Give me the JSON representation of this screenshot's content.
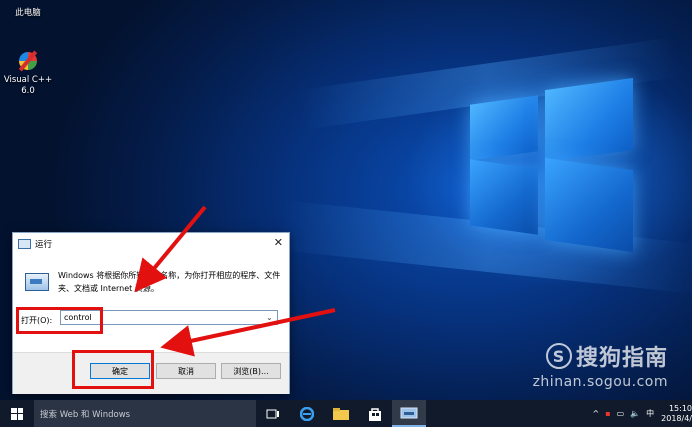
{
  "desktop": {
    "icons": [
      {
        "label": "此电脑"
      },
      {
        "label": "Visual C++",
        "label2": "6.0"
      }
    ]
  },
  "watermark": {
    "logo_letter": "S",
    "brand": "搜狗指南",
    "url": "zhinan.sogou.com"
  },
  "run_dialog": {
    "title": "运行",
    "close_glyph": "✕",
    "description": "Windows 将根据你所输入的名称，为你打开相应的程序、文件夹、文档或 Internet 资源。",
    "open_label": "打开(O):",
    "input_value": "control",
    "dropdown_glyph": "⌄",
    "buttons": {
      "ok": "确定",
      "cancel": "取消",
      "browse": "浏览(B)..."
    }
  },
  "taskbar": {
    "search_placeholder": "搜索 Web 和 Windows",
    "tray": {
      "chevron": "^",
      "volume": "🔈",
      "ime": "中"
    },
    "clock": {
      "time": "15:10",
      "date": "2018/4/"
    }
  },
  "colors": {
    "highlight": "#e31010",
    "accent": "#0078d7",
    "taskbar": "#101a2a"
  }
}
